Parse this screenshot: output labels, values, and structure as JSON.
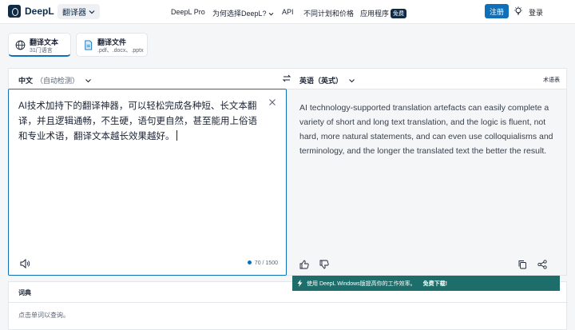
{
  "header": {
    "brand": "DeepL",
    "product": "翻译器",
    "nav": [
      "DeepL Pro",
      "为何选择DeepL?",
      "API",
      "不同计划和价格",
      "应用程序"
    ],
    "free_badge": "免费",
    "signup": "注册",
    "login": "登录"
  },
  "tabs": [
    {
      "title": "翻译文本",
      "subtitle": "31门语言"
    },
    {
      "title": "翻译文件",
      "subtitle": ".pdf、.docx、.pptx"
    }
  ],
  "source": {
    "lang": "中文",
    "detected": "（自动检测）",
    "text": "AI技术加持下的翻译神器，可以轻松完成各种短、长文本翻译，并且逻辑通畅，不生硬，语句更自然，甚至能用上俗语和专业术语，翻译文本越长效果越好。",
    "char_count": "70 / 1500"
  },
  "target": {
    "lang": "英语（英式）",
    "glossary": "术语表",
    "text": "AI technology-supported translation artefacts can easily complete a variety of short and long text translation, and the logic is fluent, not hard, more natural statements, and can even use colloquialisms and terminology, and the longer the translated text the better the result."
  },
  "banner": {
    "text": "使用 DeepL Windows版提高你的工作效率。",
    "cta": "免费下载!"
  },
  "dictionary": {
    "title": "词典",
    "hint": "点击单词以查询。"
  },
  "colors": {
    "accent": "#0f6fb9",
    "brand": "#0f2b46",
    "banner": "#1d6e6a"
  }
}
